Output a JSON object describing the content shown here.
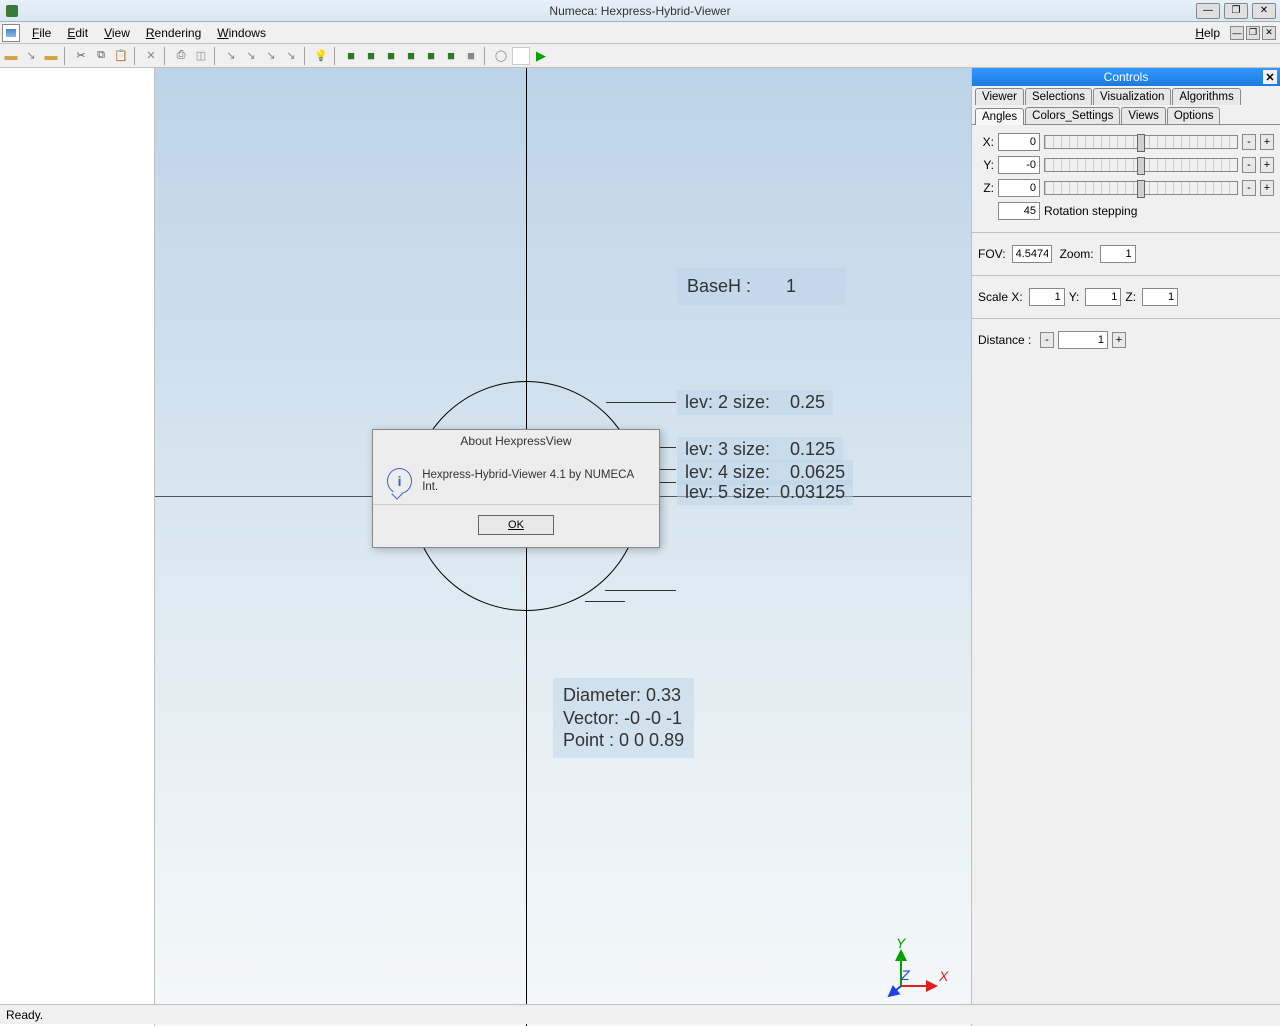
{
  "title": "Numeca: Hexpress-Hybrid-Viewer",
  "menu": {
    "file": "File",
    "edit": "Edit",
    "view": "View",
    "rendering": "Rendering",
    "windows": "Windows",
    "help": "Help"
  },
  "controls": {
    "title": "Controls",
    "tabs_row1": [
      "Viewer",
      "Selections",
      "Visualization",
      "Algorithms"
    ],
    "tabs_row2": [
      "Angles",
      "Colors_Settings",
      "Views",
      "Options"
    ],
    "angles": {
      "x_label": "X:",
      "x_value": "0",
      "y_label": "Y:",
      "y_value": "-0",
      "z_label": "Z:",
      "z_value": "0",
      "rot_step_value": "45",
      "rot_step_label": "Rotation stepping"
    },
    "fov": {
      "label": "FOV:",
      "value": "4.5474",
      "zoom_label": "Zoom:",
      "zoom_value": "1"
    },
    "scale": {
      "x_label": "Scale X:",
      "x": "1",
      "y_label": "Y:",
      "y": "1",
      "z_label": "Z:",
      "z": "1"
    },
    "distance": {
      "label": "Distance :",
      "value": "1"
    }
  },
  "viewport": {
    "baseh": "BaseH :       1",
    "lev2": "lev: 2 size:    0.25",
    "lev3": "lev: 3 size:    0.125",
    "lev4": "lev: 4 size:    0.0625",
    "lev5": "lev: 5 size:  0.03125",
    "info_diameter": "Diameter:    0.33",
    "info_vector": "Vector:      -0       -0       -1",
    "info_point": "Point :        0        0    0.89",
    "axis_x": "X",
    "axis_y": "Y",
    "axis_z": "Z"
  },
  "dialog": {
    "title": "About HexpressView",
    "text": "Hexpress-Hybrid-Viewer 4.1 by NUMECA Int.",
    "ok": "OK"
  },
  "status": "Ready."
}
